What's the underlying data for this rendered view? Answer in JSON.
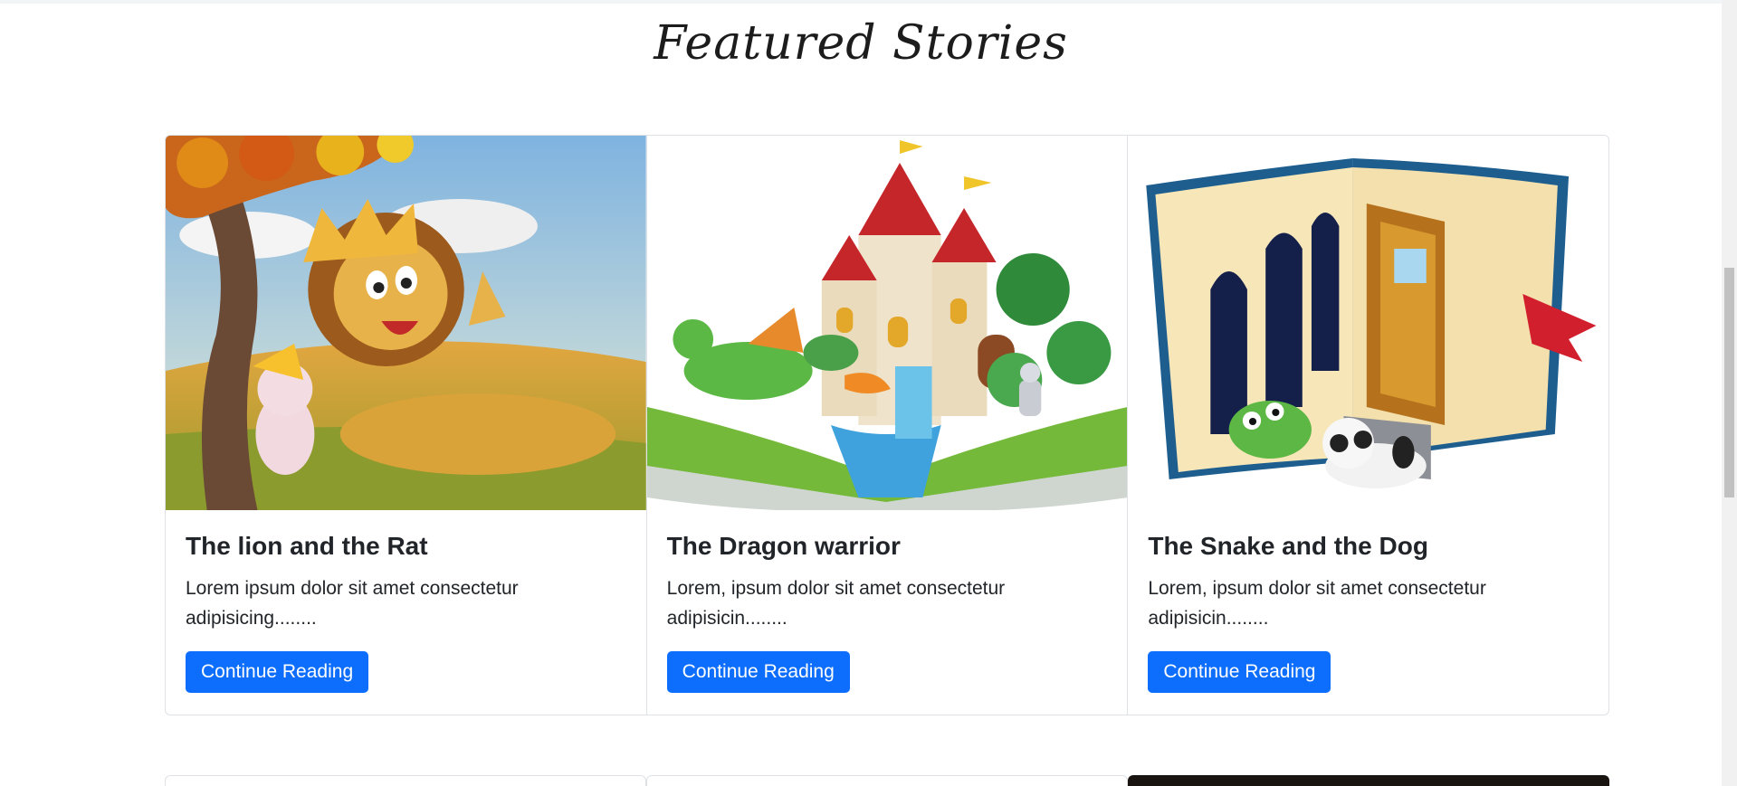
{
  "page": {
    "section_title": "Featured Stories"
  },
  "colors": {
    "primary_button": "#0d6efd",
    "card_border": "#dee2e6",
    "text": "#212529"
  },
  "stories": [
    {
      "title": "The lion and the Rat",
      "text": "Lorem ipsum dolor sit amet consectetur adipisicing........",
      "button_label": "Continue Reading",
      "image_icon": "lion-and-rat-illustration"
    },
    {
      "title": "The Dragon warrior",
      "text": "Lorem, ipsum dolor sit amet consectetur adipisicin........",
      "button_label": "Continue Reading",
      "image_icon": "dragon-castle-book-illustration"
    },
    {
      "title": "The Snake and the Dog",
      "text": "Lorem, ipsum dolor sit amet consectetur adipisicin........",
      "button_label": "Continue Reading",
      "image_icon": "snake-dog-book-illustration"
    }
  ]
}
